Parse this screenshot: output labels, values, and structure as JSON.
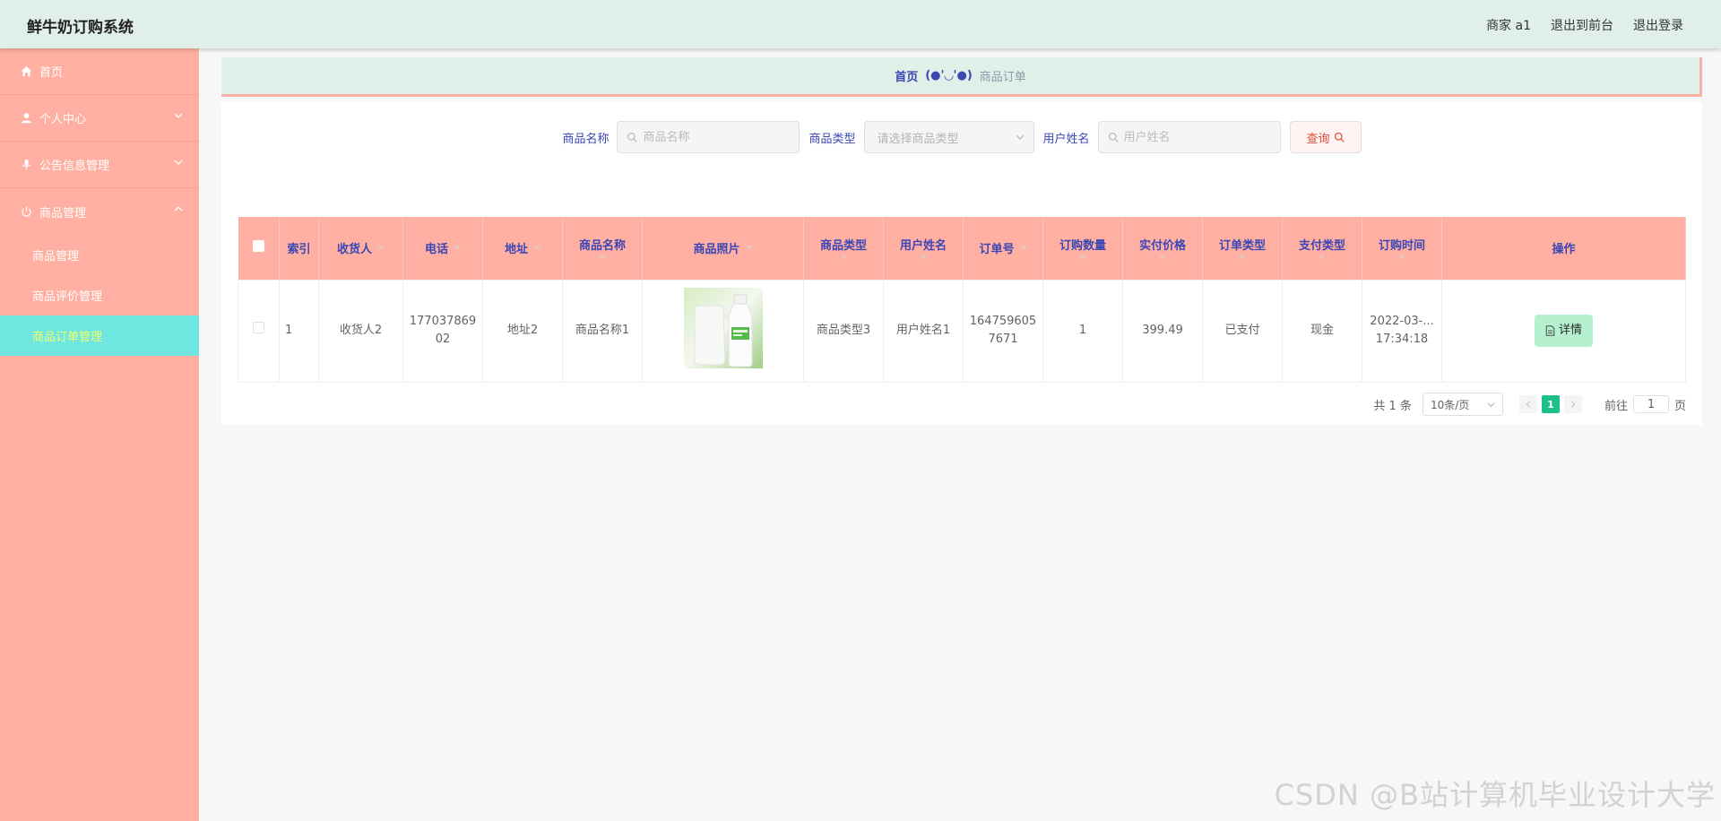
{
  "header": {
    "app_title": "鲜牛奶订购系统",
    "user": "商家 a1",
    "to_front": "退出到前台",
    "logout": "退出登录"
  },
  "sidebar": {
    "items": [
      {
        "label": "首页",
        "icon": "home-icon"
      },
      {
        "label": "个人中心",
        "icon": "user-icon"
      },
      {
        "label": "公告信息管理",
        "icon": "mic-icon"
      },
      {
        "label": "商品管理",
        "icon": "power-icon"
      }
    ],
    "sub_items": [
      {
        "label": "商品管理"
      },
      {
        "label": "商品评价管理"
      },
      {
        "label": "商品订单管理"
      }
    ]
  },
  "breadcrumb": {
    "home": "首页",
    "separator": "(●'◡'●)",
    "current": "商品订单"
  },
  "search": {
    "name_label": "商品名称",
    "name_placeholder": "商品名称",
    "type_label": "商品类型",
    "type_placeholder": "请选择商品类型",
    "user_label": "用户姓名",
    "user_placeholder": "用户姓名",
    "query_label": "查询"
  },
  "table": {
    "headers": [
      "索引",
      "收货人",
      "电话",
      "地址",
      "商品名称",
      "商品照片",
      "商品类型",
      "用户姓名",
      "订单号",
      "订购数量",
      "实付价格",
      "订单类型",
      "支付类型",
      "订购时间",
      "操作"
    ],
    "rows": [
      {
        "index": "1",
        "receiver": "收货人2",
        "phone_l1": "177037869",
        "phone_l2": "02",
        "address": "地址2",
        "product_name": "商品名称1",
        "product_type": "商品类型3",
        "user_name": "用户姓名1",
        "order_no_l1": "164759605",
        "order_no_l2": "7671",
        "quantity": "1",
        "price": "399.49",
        "order_type": "已支付",
        "pay_type": "现金",
        "time_l1": "2022-03-...",
        "time_l2": "17:34:18",
        "action": "详情"
      }
    ]
  },
  "pagination": {
    "total": "共 1 条",
    "page_size": "10条/页",
    "current_page": "1",
    "goto_label": "前往",
    "goto_value": "1",
    "page_suffix": "页"
  },
  "watermark": "CSDN @B站计算机毕业设计大学",
  "colors": {
    "header_bg": "#e0efe8",
    "sidebar_bg": "#ffb0a2",
    "active_item": "#6ee7e0",
    "table_header": "#ffb0a2",
    "accent_text": "#3c46b4",
    "page_active": "#1ec08a"
  }
}
